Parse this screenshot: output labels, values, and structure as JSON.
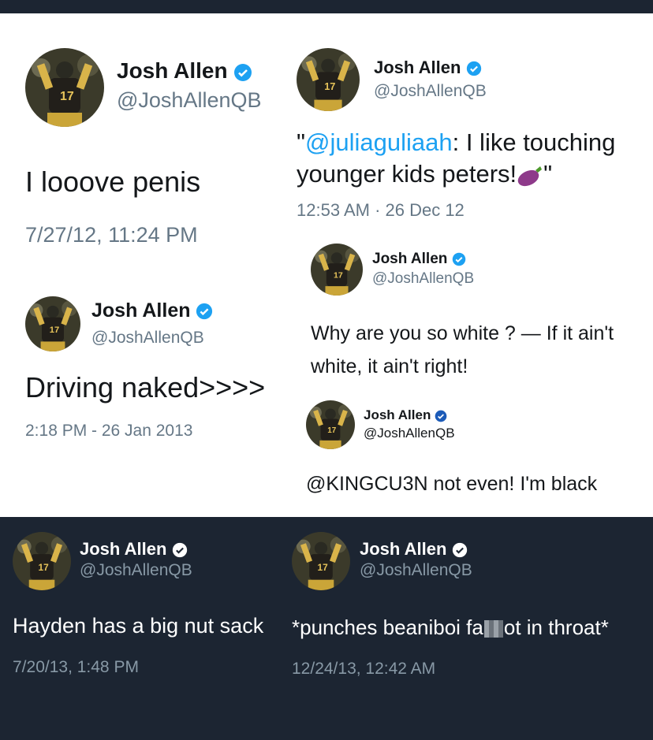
{
  "colors": {
    "dark_bg": "#1c2532",
    "verified": "#1da1f2",
    "mention": "#1da1f2",
    "muted": "#657786"
  },
  "tweets": [
    {
      "name": "Josh Allen",
      "handle": "@JoshAllenQB",
      "text": "I looove penis",
      "time": "7/27/12, 11:24 PM"
    },
    {
      "name": "Josh Allen",
      "handle": "@JoshAllenQB",
      "mention": "@juliaguliaah",
      "text_rest": ": I like touching",
      "text_line2": "younger kids peters!",
      "quote_open": "\"",
      "quote_close": "\"",
      "emoji": "eggplant-icon",
      "time": "12:53 AM · 26 Dec 12"
    },
    {
      "name": "Josh Allen",
      "handle": "@JoshAllenQB",
      "text": "Driving naked>>>>",
      "time": "2:18 PM - 26 Jan 2013"
    },
    {
      "name": "Josh Allen",
      "handle": "@JoshAllenQB",
      "text_line1": "Why are you so white ? — If it ain't",
      "text_line2": "white, it ain't right!"
    },
    {
      "name": "Josh Allen",
      "handle": "@JoshAllenQB",
      "text": "@KINGCU3N not even! I'm black"
    },
    {
      "name": "Josh Allen",
      "handle": "@JoshAllenQB",
      "text": "Hayden has a big nut sack",
      "time": "7/20/13, 1:48 PM"
    },
    {
      "name": "Josh Allen",
      "handle": "@JoshAllenQB",
      "text_before": "*punches beaniboi fa",
      "text_after": "ot in throat*",
      "time": "12/24/13, 12:42 AM"
    }
  ]
}
